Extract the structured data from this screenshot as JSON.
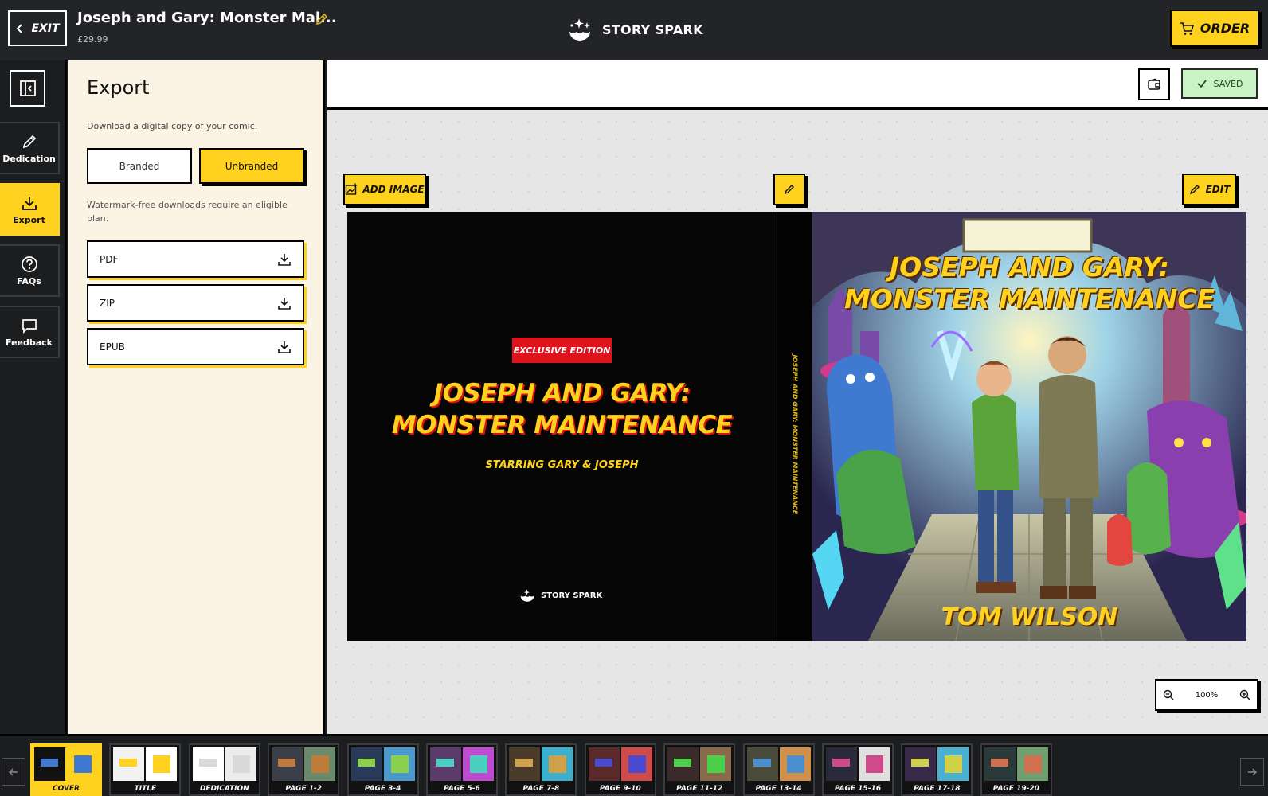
{
  "header": {
    "exit_label": "EXIT",
    "title": "Joseph and Gary: Monster Mai...",
    "price": "£29.99",
    "brand": "STORY SPARK",
    "order_label": "ORDER"
  },
  "rail": {
    "items": [
      {
        "label": "Dedication",
        "icon": "pencil-icon"
      },
      {
        "label": "Export",
        "icon": "download-icon",
        "active": true
      },
      {
        "label": "FAQs",
        "icon": "help-icon"
      },
      {
        "label": "Feedback",
        "icon": "message-icon"
      }
    ]
  },
  "export_panel": {
    "heading": "Export",
    "description": "Download a digital copy of your comic.",
    "mode_branded": "Branded",
    "mode_unbranded": "Unbranded",
    "selected_mode": "Unbranded",
    "note": "Watermark-free downloads require an eligible plan.",
    "formats": [
      {
        "label": "PDF"
      },
      {
        "label": "ZIP"
      },
      {
        "label": "EPUB"
      }
    ]
  },
  "editor": {
    "status": "SAVED",
    "add_image_label": "ADD IMAGE",
    "edit_label": "EDIT",
    "zoom": "100%"
  },
  "cover": {
    "badge": "EXCLUSIVE EDITION",
    "back_title_line1": "JOSEPH AND GARY:",
    "back_title_line2": "MONSTER MAINTENANCE",
    "back_subtitle": "STARRING GARY & JOSEPH",
    "back_brand": "STORY SPARK",
    "spine_text": "JOSEPH AND GARY: MONSTER MAINTENANCE",
    "front_title_line1": "JOSEPH AND GARY:",
    "front_title_line2": "MONSTER MAINTENANCE",
    "author": "TOM WILSON"
  },
  "filmstrip": {
    "pages": [
      "COVER",
      "TITLE",
      "DEDICATION",
      "PAGE 1-2",
      "PAGE 3-4",
      "PAGE 5-6",
      "PAGE 7-8",
      "PAGE 9-10",
      "PAGE 11-12",
      "PAGE 13-14",
      "PAGE 15-16",
      "PAGE 17-18",
      "PAGE 19-20"
    ],
    "active": "COVER"
  },
  "colors": {
    "accent": "#ffd21f",
    "dark": "#1c1d1f",
    "panel": "#fbf3e4",
    "saved_bg": "#c9f3c4",
    "badge_red": "#e0121b"
  }
}
